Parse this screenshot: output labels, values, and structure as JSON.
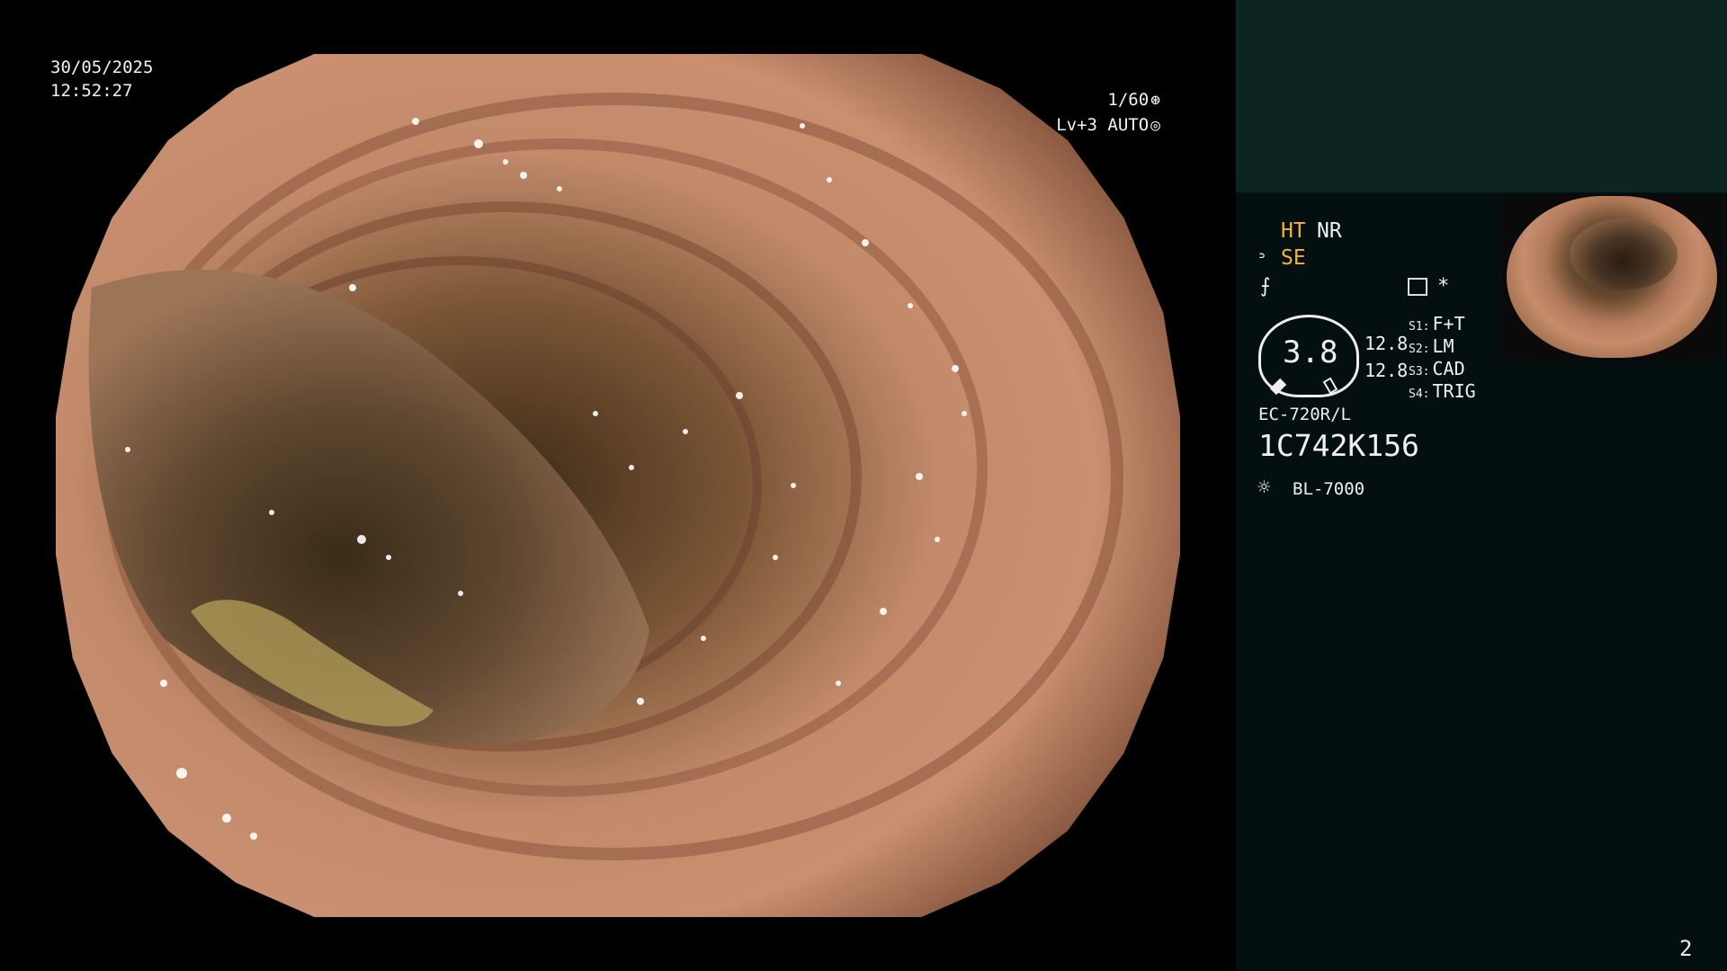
{
  "overlay": {
    "date": "30/05/2025",
    "time": "12:52:27",
    "shutter": "1/60",
    "shutter_icon": "⊛",
    "level": "Lv+3 AUTO",
    "level_icon": "◎"
  },
  "panel": {
    "ht": "HT",
    "nr": "NR",
    "se": "SE",
    "se_icon": "ᐣ",
    "curve_icon": "⨍",
    "star_icon": "*",
    "dial_value": "3.8",
    "ratio_1": "12.8",
    "ratio_2": "12.8",
    "switches": [
      {
        "key": "S1:",
        "value": "F+T"
      },
      {
        "key": "S2:",
        "value": "LM"
      },
      {
        "key": "S3:",
        "value": "CAD"
      },
      {
        "key": "S4:",
        "value": "TRIG"
      }
    ],
    "scope_model": "EC-720R/L",
    "serial": "1C742K156",
    "lamp_icon": "☼",
    "lamp": "BL-7000",
    "page": "2"
  },
  "colors": {
    "highlight": "#f0b43a",
    "panel_bg": "#04100f",
    "panel_top_bg": "#0c2522"
  }
}
